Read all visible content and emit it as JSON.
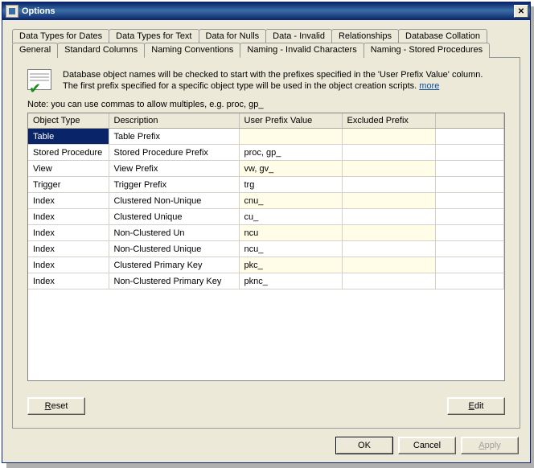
{
  "window": {
    "title": "Options",
    "close_glyph": "✕"
  },
  "tabs_row1": [
    "Data Types for Dates",
    "Data Types for Text",
    "Data for Nulls",
    "Data - Invalid",
    "Relationships",
    "Database Collation"
  ],
  "tabs_row2": [
    "General",
    "Standard Columns",
    "Naming Conventions",
    "Naming - Invalid Characters",
    "Naming - Stored Procedures"
  ],
  "active_tab": "Naming Conventions",
  "info": {
    "line1": "Database object names will be checked to start with the prefixes specified in the 'User Prefix Value' column.",
    "line2_prefix": "The first prefix specified for a specific object type will be used in the object creation scripts.",
    "more_label": "more"
  },
  "note": "Note: you can use commas to allow multiples, e.g. proc, gp_",
  "columns": [
    "Object Type",
    "Description",
    "User Prefix Value",
    "Excluded Prefix",
    ""
  ],
  "rows": [
    {
      "type": "Table",
      "desc": "Table Prefix",
      "user": "",
      "excl": ""
    },
    {
      "type": "Stored Procedure",
      "desc": "Stored Procedure Prefix",
      "user": "proc, gp_",
      "excl": ""
    },
    {
      "type": "View",
      "desc": "View Prefix",
      "user": "vw, gv_",
      "excl": ""
    },
    {
      "type": "Trigger",
      "desc": "Trigger Prefix",
      "user": "trg",
      "excl": ""
    },
    {
      "type": "Index",
      "desc": "Clustered Non-Unique",
      "user": "cnu_",
      "excl": ""
    },
    {
      "type": "Index",
      "desc": "Clustered Unique",
      "user": "cu_",
      "excl": ""
    },
    {
      "type": "Index",
      "desc": "Non-Clustered Un",
      "user": "ncu",
      "excl": ""
    },
    {
      "type": "Index",
      "desc": "Non-Clustered Unique",
      "user": "ncu_",
      "excl": ""
    },
    {
      "type": "Index",
      "desc": "Clustered Primary Key",
      "user": "pkc_",
      "excl": ""
    },
    {
      "type": "Index",
      "desc": "Non-Clustered Primary Key",
      "user": "pknc_",
      "excl": ""
    }
  ],
  "selected_row": 0,
  "panel_buttons": {
    "reset": "Reset",
    "edit": "Edit"
  },
  "dialog_buttons": {
    "ok": "OK",
    "cancel": "Cancel",
    "apply": "Apply"
  }
}
